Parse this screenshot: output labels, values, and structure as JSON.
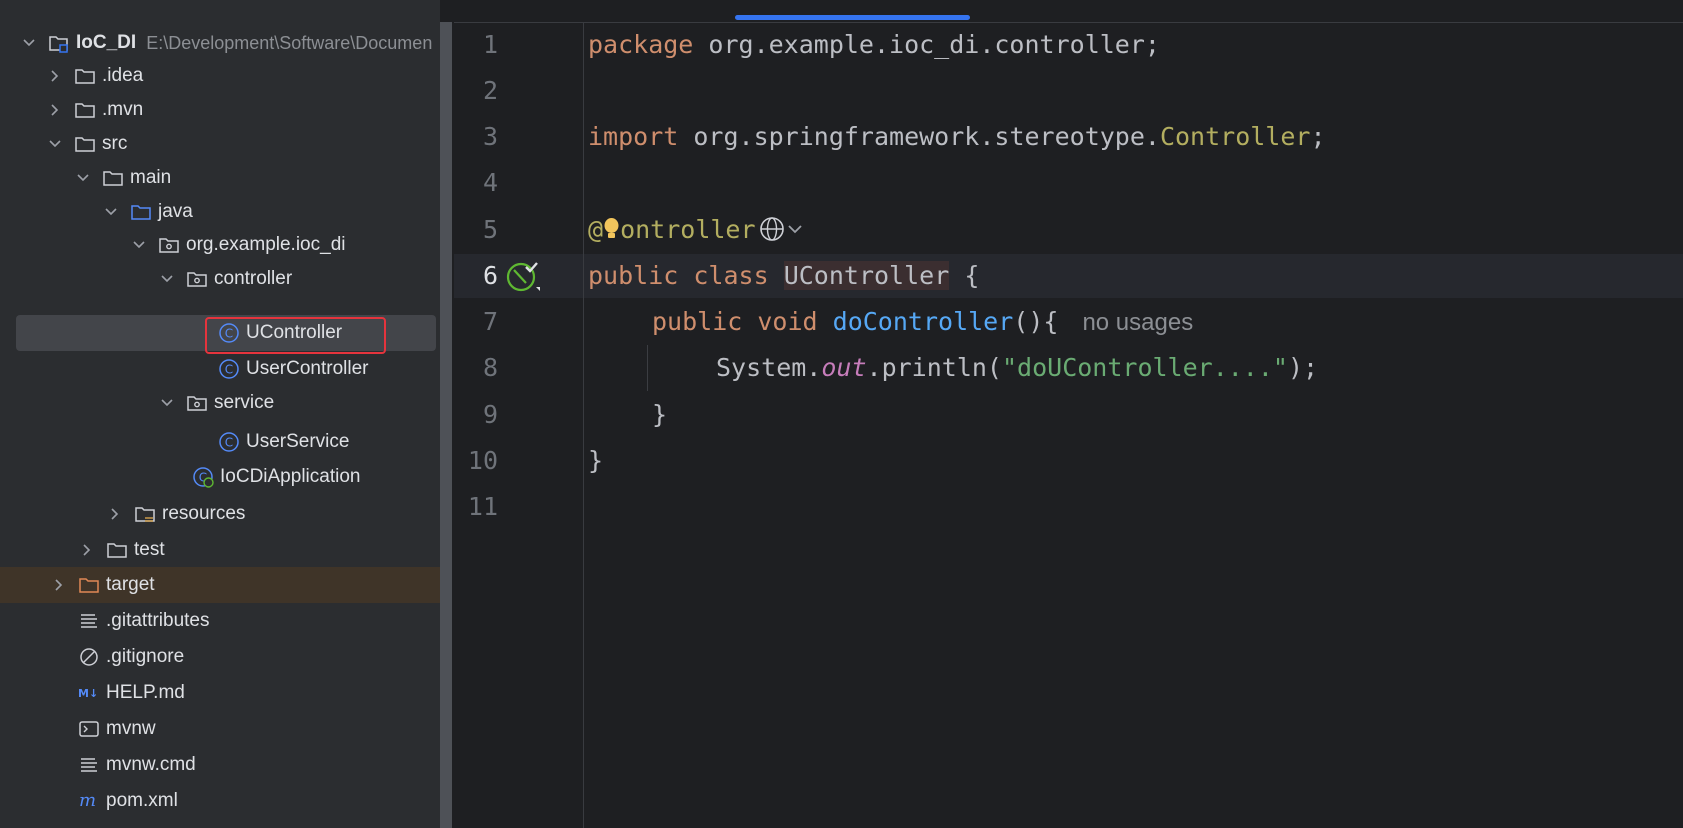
{
  "project_tree": {
    "root": {
      "label": "IoC_DI",
      "path": "E:\\Development\\Software\\Documen"
    },
    "items": [
      {
        "label": ".idea"
      },
      {
        "label": ".mvn"
      },
      {
        "label": "src"
      },
      {
        "label": "main"
      },
      {
        "label": "java"
      },
      {
        "label": "org.example.ioc_di"
      },
      {
        "label": "controller"
      },
      {
        "label": "UController"
      },
      {
        "label": "UserController"
      },
      {
        "label": "service"
      },
      {
        "label": "UserService"
      },
      {
        "label": "IoCDiApplication"
      },
      {
        "label": "resources"
      },
      {
        "label": "test"
      },
      {
        "label": "target"
      },
      {
        "label": ".gitattributes"
      },
      {
        "label": ".gitignore"
      },
      {
        "label": "HELP.md"
      },
      {
        "label": "mvnw"
      },
      {
        "label": "mvnw.cmd"
      },
      {
        "label": "pom.xml"
      }
    ]
  },
  "editor": {
    "line_numbers": [
      "1",
      "2",
      "3",
      "4",
      "5",
      "6",
      "7",
      "8",
      "9",
      "10",
      "11"
    ],
    "code": {
      "l1_kw": "package",
      "l1_rest": " org.example.ioc_di.controller;",
      "l3_kw": "import",
      "l3_pkg": " org.springframework.stereotype.",
      "l3_cls": "Controller",
      "l3_semi": ";",
      "l5_at": "@",
      "l5_ann": "ontroller",
      "l6_kw1": "public",
      "l6_kw2": "class",
      "l6_name": "UController",
      "l6_brace": " {",
      "l7_kw1": "public",
      "l7_kw2": "void",
      "l7_fn": "doController",
      "l7_rest": "(){",
      "l7_hint": "no usages",
      "l8_obj": "System.",
      "l8_field": "out",
      "l8_call": ".println(",
      "l8_str": "\"doUController....\"",
      "l8_end": ");",
      "l9": "}",
      "l10": "}"
    }
  }
}
